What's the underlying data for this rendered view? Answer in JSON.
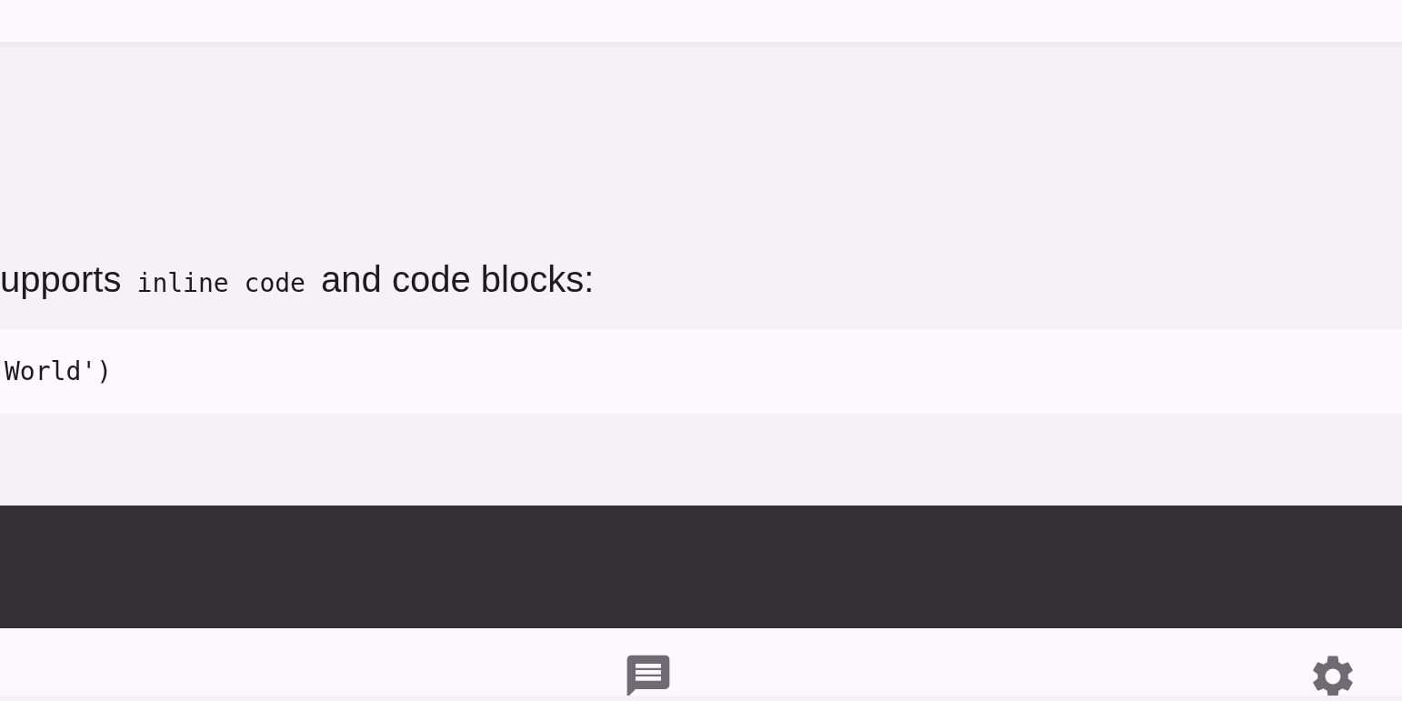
{
  "paragraph": {
    "before": "upports",
    "code": "inline code",
    "after": "and code blocks:"
  },
  "code_block": {
    "text": "World')"
  },
  "bottom_nav": [
    {
      "kind": "message"
    },
    {
      "kind": "settings"
    }
  ]
}
